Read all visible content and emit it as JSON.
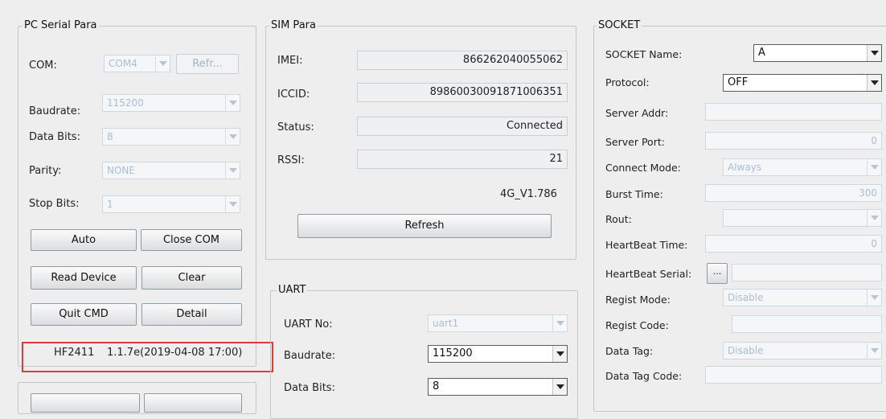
{
  "pc_serial": {
    "title": "PC Serial Para",
    "com_label": "COM:",
    "com_value": "COM4",
    "refresh_label": "Refr...",
    "baudrate_label": "Baudrate:",
    "baudrate_value": "115200",
    "databits_label": "Data Bits:",
    "databits_value": "8",
    "parity_label": "Parity:",
    "parity_value": "NONE",
    "stopbits_label": "Stop Bits:",
    "stopbits_value": "1",
    "buttons": {
      "auto": "Auto",
      "close_com": "Close COM",
      "read_device": "Read Device",
      "clear": "Clear",
      "quit_cmd": "Quit CMD",
      "detail": "Detail"
    },
    "device_model": "HF2411",
    "device_version": "1.1.7e(2019-04-08 17:00)"
  },
  "sim": {
    "title": "SIM Para",
    "imei_label": "IMEI:",
    "imei_value": "866262040055062",
    "iccid_label": "ICCID:",
    "iccid_value": "89860030091871006351",
    "status_label": "Status:",
    "status_value": "Connected",
    "rssi_label": "RSSI:",
    "rssi_value": "21",
    "version": "4G_V1.786",
    "refresh_button": "Refresh"
  },
  "uart": {
    "title": "UART",
    "no_label": "UART No:",
    "no_value": "uart1",
    "baudrate_label": "Baudrate:",
    "baudrate_value": "115200",
    "databits_label": "Data Bits:",
    "databits_value": "8"
  },
  "socket": {
    "title": "SOCKET",
    "name_label": "SOCKET Name:",
    "name_value": "A",
    "protocol_label": "Protocol:",
    "protocol_value": "OFF",
    "server_addr_label": "Server Addr:",
    "server_addr_value": "",
    "server_port_label": "Server Port:",
    "server_port_value": "0",
    "connect_mode_label": "Connect Mode:",
    "connect_mode_value": "Always",
    "burst_time_label": "Burst Time:",
    "burst_time_value": "300",
    "rout_label": "Rout:",
    "rout_value": "",
    "heartbeat_time_label": "HeartBeat Time:",
    "heartbeat_time_value": "0",
    "heartbeat_serial_label": "HeartBeat Serial:",
    "heartbeat_serial_button": "...",
    "regist_mode_label": "Regist Mode:",
    "regist_mode_value": "Disable",
    "regist_code_label": "Regist Code:",
    "data_tag_label": "Data Tag:",
    "data_tag_value": "Disable",
    "data_tag_code_label": "Data Tag Code:"
  }
}
